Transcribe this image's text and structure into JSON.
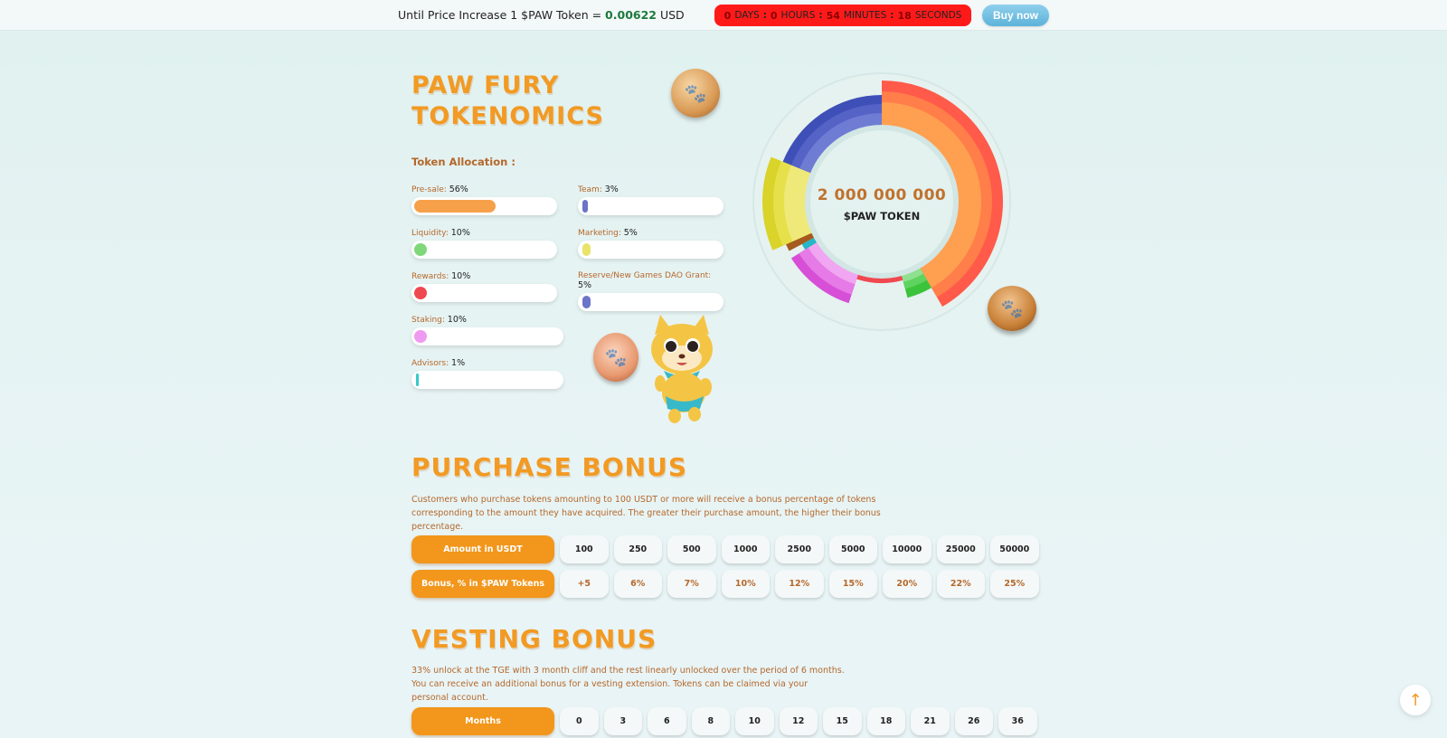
{
  "topbar": {
    "price_prefix": "Until Price Increase 1 $PAW Token =",
    "price_value": "0.00622",
    "price_unit": "USD",
    "countdown": {
      "days": "0",
      "days_label": "DAYS",
      "hours": "0",
      "hours_label": "HOURS",
      "minutes": "54",
      "minutes_label": "MINUTES",
      "seconds": "18",
      "seconds_label": "SECONDS"
    },
    "buy_label": "Buy now"
  },
  "tokenomics": {
    "title_line1": "PAW FURY",
    "title_line2": "TOKENOMICS",
    "allocation_label": "Token Allocation :",
    "items": [
      {
        "label": "Pre-sale:",
        "pct": "56%",
        "value": 56,
        "color": "#f7a04a"
      },
      {
        "label": "Team:",
        "pct": "3%",
        "value": 3,
        "color": "#6b74c9"
      },
      {
        "label": "Liquidity:",
        "pct": "10%",
        "value": 10,
        "color": "#7ed87a"
      },
      {
        "label": "Marketing:",
        "pct": "5%",
        "value": 5,
        "color": "#e9e36a"
      },
      {
        "label": "Rewards:",
        "pct": "10%",
        "value": 10,
        "color": "#f0484f"
      },
      {
        "label": "Reserve/New Games DAO Grant:",
        "pct": "5%",
        "value": 5,
        "color": "#6b74c9"
      },
      {
        "label": "Staking:",
        "pct": "10%",
        "value": 10,
        "color": "#ef9af0"
      },
      {
        "label": "Advisors:",
        "pct": "1%",
        "value": 1,
        "color": "#38c9c9"
      }
    ],
    "total_supply": "2 000 000 000",
    "token_name": "$PAW TOKEN"
  },
  "purchase_bonus": {
    "title": "PURCHASE BONUS",
    "description": "Customers who purchase tokens amounting to 100 USDT or more will receive a bonus percentage of tokens corresponding to the amount they have acquired. The greater their purchase amount, the higher their bonus percentage.",
    "amount_label": "Amount in USDT",
    "amounts": [
      "100",
      "250",
      "500",
      "1000",
      "2500",
      "5000",
      "10000",
      "25000",
      "50000"
    ],
    "bonus_label": "Bonus, % in $PAW Tokens",
    "bonuses": [
      "+5",
      "6%",
      "7%",
      "10%",
      "12%",
      "15%",
      "20%",
      "22%",
      "25%"
    ]
  },
  "vesting_bonus": {
    "title": "VESTING BONUS",
    "description": "33% unlock at the TGE with 3 month cliff and the rest linearly unlocked over the period of 6 months. You can receive an additional bonus for a vesting extension. Tokens can be claimed via your personal account.",
    "months_label": "Months",
    "months": [
      "0",
      "3",
      "6",
      "8",
      "10",
      "12",
      "15",
      "18",
      "21",
      "26",
      "36"
    ]
  },
  "icons": {
    "scroll_top": "arrow-up-icon",
    "coin": "paw-coin-icon"
  }
}
